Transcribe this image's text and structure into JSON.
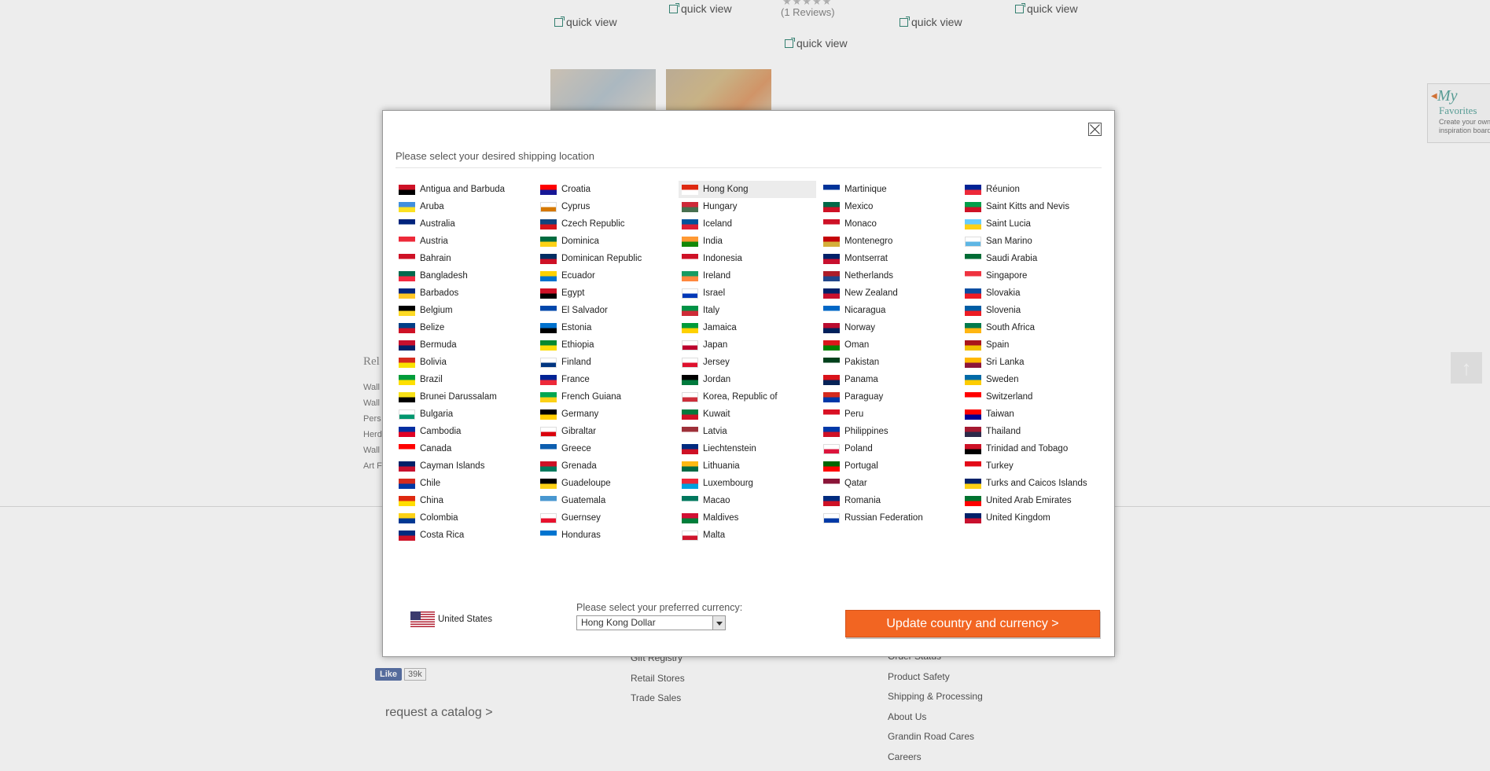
{
  "background": {
    "quick_view_label": "quick view",
    "reviews": "(1 Reviews)",
    "stars": "★★★★★",
    "favorites": {
      "my": "My",
      "title": "Favorites",
      "subtitle": "Create your own inspiration board"
    },
    "related_title": "Rel",
    "related_items": [
      "Wall",
      "Wall",
      "Pers",
      "Herd",
      "Wall",
      "Art F"
    ],
    "fb_like": "Like",
    "fb_count": "39k",
    "catalog_link": "request a catalog >",
    "footer_col2": [
      "Gift Registry",
      "Retail Stores",
      "Trade Sales"
    ],
    "footer_col3": [
      "Order Status",
      "Product Safety",
      "Shipping & Processing",
      "About Us",
      "Grandin Road Cares",
      "Careers"
    ]
  },
  "modal": {
    "title": "Please select your desired shipping location",
    "selected_country": "Hong Kong",
    "columns": [
      [
        "Antigua and Barbuda",
        "Aruba",
        "Australia",
        "Austria",
        "Bahrain",
        "Bangladesh",
        "Barbados",
        "Belgium",
        "Belize",
        "Bermuda",
        "Bolivia",
        "Brazil",
        "Brunei Darussalam",
        "Bulgaria",
        "Cambodia",
        "Canada",
        "Cayman Islands",
        "Chile",
        "China",
        "Colombia",
        "Costa Rica"
      ],
      [
        "Croatia",
        "Cyprus",
        "Czech Republic",
        "Dominica",
        "Dominican Republic",
        "Ecuador",
        "Egypt",
        "El Salvador",
        "Estonia",
        "Ethiopia",
        "Finland",
        "France",
        "French Guiana",
        "Germany",
        "Gibraltar",
        "Greece",
        "Grenada",
        "Guadeloupe",
        "Guatemala",
        "Guernsey",
        "Honduras"
      ],
      [
        "Hong Kong",
        "Hungary",
        "Iceland",
        "India",
        "Indonesia",
        "Ireland",
        "Israel",
        "Italy",
        "Jamaica",
        "Japan",
        "Jersey",
        "Jordan",
        "Korea, Republic of",
        "Kuwait",
        "Latvia",
        "Liechtenstein",
        "Lithuania",
        "Luxembourg",
        "Macao",
        "Maldives",
        "Malta"
      ],
      [
        "Martinique",
        "Mexico",
        "Monaco",
        "Montenegro",
        "Montserrat",
        "Netherlands",
        "New Zealand",
        "Nicaragua",
        "Norway",
        "Oman",
        "Pakistan",
        "Panama",
        "Paraguay",
        "Peru",
        "Philippines",
        "Poland",
        "Portugal",
        "Qatar",
        "Romania",
        "Russian Federation"
      ],
      [
        "Réunion",
        "Saint Kitts and Nevis",
        "Saint Lucia",
        "San Marino",
        "Saudi Arabia",
        "Singapore",
        "Slovakia",
        "Slovenia",
        "South Africa",
        "Spain",
        "Sri Lanka",
        "Sweden",
        "Switzerland",
        "Taiwan",
        "Thailand",
        "Trinidad and Tobago",
        "Turkey",
        "Turks and Caicos Islands",
        "United Arab Emirates",
        "United Kingdom"
      ]
    ],
    "flag_colors": {
      "Antigua and Barbuda": [
        "#ce1126",
        "#000000"
      ],
      "Aruba": [
        "#418fde",
        "#fbe122"
      ],
      "Australia": [
        "#00247d",
        "#ffffff"
      ],
      "Austria": [
        "#ed2939",
        "#ffffff"
      ],
      "Bahrain": [
        "#ce1126",
        "#ffffff"
      ],
      "Bangladesh": [
        "#006a4e",
        "#f42a41"
      ],
      "Barbados": [
        "#00267f",
        "#ffc726"
      ],
      "Belgium": [
        "#000000",
        "#fdda24"
      ],
      "Belize": [
        "#003f87",
        "#ce1126"
      ],
      "Bermuda": [
        "#c8102e",
        "#012169"
      ],
      "Bolivia": [
        "#d52b1e",
        "#f9e300"
      ],
      "Brazil": [
        "#009c3b",
        "#ffdf00"
      ],
      "Brunei Darussalam": [
        "#f7e017",
        "#000000"
      ],
      "Bulgaria": [
        "#ffffff",
        "#00966e"
      ],
      "Cambodia": [
        "#032ea1",
        "#e00025"
      ],
      "Canada": [
        "#ff0000",
        "#ffffff"
      ],
      "Cayman Islands": [
        "#012169",
        "#c8102e"
      ],
      "Chile": [
        "#d52b1e",
        "#0039a6"
      ],
      "China": [
        "#de2910",
        "#ffde00"
      ],
      "Colombia": [
        "#fcd116",
        "#003893"
      ],
      "Costa Rica": [
        "#002b7f",
        "#ce1126"
      ],
      "Croatia": [
        "#ff0000",
        "#171796"
      ],
      "Cyprus": [
        "#ffffff",
        "#d57800"
      ],
      "Czech Republic": [
        "#11457e",
        "#d7141a"
      ],
      "Dominica": [
        "#006b3f",
        "#fcd116"
      ],
      "Dominican Republic": [
        "#002d62",
        "#ce1126"
      ],
      "Ecuador": [
        "#ffd100",
        "#0072ce"
      ],
      "Egypt": [
        "#ce1126",
        "#000000"
      ],
      "El Salvador": [
        "#0047ab",
        "#ffffff"
      ],
      "Estonia": [
        "#0072ce",
        "#000000"
      ],
      "Ethiopia": [
        "#078930",
        "#fcdd09"
      ],
      "Finland": [
        "#ffffff",
        "#003580"
      ],
      "France": [
        "#002395",
        "#ed2939"
      ],
      "French Guiana": [
        "#00a651",
        "#fcd116"
      ],
      "Germany": [
        "#000000",
        "#ffce00"
      ],
      "Gibraltar": [
        "#ffffff",
        "#da000c"
      ],
      "Greece": [
        "#0d5eaf",
        "#ffffff"
      ],
      "Grenada": [
        "#ce1126",
        "#007a5e"
      ],
      "Guadeloupe": [
        "#000000",
        "#fcd116"
      ],
      "Guatemala": [
        "#4997d0",
        "#ffffff"
      ],
      "Guernsey": [
        "#ffffff",
        "#e8112d"
      ],
      "Honduras": [
        "#0073cf",
        "#ffffff"
      ],
      "Hong Kong": [
        "#de2910",
        "#ffffff"
      ],
      "Hungary": [
        "#ce2939",
        "#477050"
      ],
      "Iceland": [
        "#02529c",
        "#dc1e35"
      ],
      "India": [
        "#ff9933",
        "#138808"
      ],
      "Indonesia": [
        "#ce1126",
        "#ffffff"
      ],
      "Ireland": [
        "#169b62",
        "#ff883e"
      ],
      "Israel": [
        "#ffffff",
        "#0038b8"
      ],
      "Italy": [
        "#009246",
        "#ce2b37"
      ],
      "Jamaica": [
        "#009b3a",
        "#fed100"
      ],
      "Japan": [
        "#ffffff",
        "#bc002d"
      ],
      "Jersey": [
        "#ffffff",
        "#df112d"
      ],
      "Jordan": [
        "#000000",
        "#007a3d"
      ],
      "Korea, Republic of": [
        "#ffffff",
        "#cd2e3a"
      ],
      "Kuwait": [
        "#007a3d",
        "#ce1126"
      ],
      "Latvia": [
        "#9e3039",
        "#ffffff"
      ],
      "Liechtenstein": [
        "#002b7f",
        "#ce1126"
      ],
      "Lithuania": [
        "#fdb913",
        "#006a44"
      ],
      "Luxembourg": [
        "#ed2939",
        "#00a1de"
      ],
      "Macao": [
        "#00785e",
        "#ffffff"
      ],
      "Maldives": [
        "#d21034",
        "#007e3a"
      ],
      "Malta": [
        "#ffffff",
        "#cf142b"
      ],
      "Martinique": [
        "#003399",
        "#ffffff"
      ],
      "Mexico": [
        "#006847",
        "#ce1126"
      ],
      "Monaco": [
        "#ce1126",
        "#ffffff"
      ],
      "Montenegro": [
        "#c40308",
        "#d4af3a"
      ],
      "Montserrat": [
        "#012169",
        "#c8102e"
      ],
      "Netherlands": [
        "#ae1c28",
        "#21468b"
      ],
      "New Zealand": [
        "#012169",
        "#c8102e"
      ],
      "Nicaragua": [
        "#0067c6",
        "#ffffff"
      ],
      "Norway": [
        "#ba0c2f",
        "#00205b"
      ],
      "Oman": [
        "#db161b",
        "#008000"
      ],
      "Pakistan": [
        "#01411c",
        "#ffffff"
      ],
      "Panama": [
        "#da121a",
        "#072357"
      ],
      "Paraguay": [
        "#d52b1e",
        "#0038a8"
      ],
      "Peru": [
        "#d91023",
        "#ffffff"
      ],
      "Philippines": [
        "#0038a8",
        "#ce1126"
      ],
      "Poland": [
        "#ffffff",
        "#dc143c"
      ],
      "Portugal": [
        "#006600",
        "#ff0000"
      ],
      "Qatar": [
        "#8a1538",
        "#ffffff"
      ],
      "Romania": [
        "#002b7f",
        "#ce1126"
      ],
      "Russian Federation": [
        "#ffffff",
        "#0039a6"
      ],
      "Réunion": [
        "#002395",
        "#ed2939"
      ],
      "Saint Kitts and Nevis": [
        "#009e49",
        "#ce1126"
      ],
      "Saint Lucia": [
        "#66ccff",
        "#fcd116"
      ],
      "San Marino": [
        "#ffffff",
        "#5eb6e4"
      ],
      "Saudi Arabia": [
        "#006c35",
        "#ffffff"
      ],
      "Singapore": [
        "#ef3340",
        "#ffffff"
      ],
      "Slovakia": [
        "#0b4ea2",
        "#ee1c25"
      ],
      "Slovenia": [
        "#005da4",
        "#ed1c24"
      ],
      "South Africa": [
        "#007a4d",
        "#ffb612"
      ],
      "Spain": [
        "#aa151b",
        "#f1bf00"
      ],
      "Sri Lanka": [
        "#ffb700",
        "#8d153a"
      ],
      "Sweden": [
        "#006aa7",
        "#fecc00"
      ],
      "Switzerland": [
        "#ff0000",
        "#ffffff"
      ],
      "Taiwan": [
        "#fe0000",
        "#000095"
      ],
      "Thailand": [
        "#a51931",
        "#2d2a4a"
      ],
      "Trinidad and Tobago": [
        "#ce1126",
        "#000000"
      ],
      "Turkey": [
        "#e30a17",
        "#ffffff"
      ],
      "Turks and Caicos Islands": [
        "#012169",
        "#fcd116"
      ],
      "United Arab Emirates": [
        "#00732f",
        "#ff0000"
      ],
      "United Kingdom": [
        "#012169",
        "#c8102e"
      ]
    },
    "current_country": "United States",
    "currency_label": "Please select your preferred currency:",
    "currency_value": "Hong Kong Dollar",
    "update_button": "Update country and currency >"
  },
  "colors": {
    "accent": "#f26522",
    "selected_row": "#ececec"
  }
}
